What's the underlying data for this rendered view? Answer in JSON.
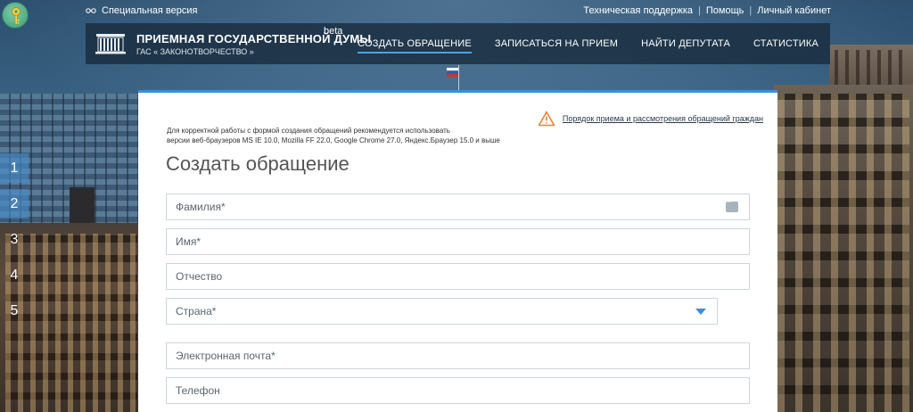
{
  "topbar": {
    "special_version": "Специальная версия",
    "links": [
      "Техническая поддержка",
      "Помощь",
      "Личный кабинет"
    ]
  },
  "header": {
    "title": "ПРИЕМНАЯ ГОСУДАРСТВЕННОЙ ДУМЫ",
    "beta": "beta",
    "subtitle": "ГАС « ЗАКОНОТВОРЧЕСТВО »",
    "nav": [
      {
        "label": "СОЗДАТЬ ОБРАЩЕНИЕ",
        "active": true
      },
      {
        "label": "ЗАПИСАТЬСЯ НА ПРИЕМ",
        "active": false
      },
      {
        "label": "НАЙТИ ДЕПУТАТА",
        "active": false
      },
      {
        "label": "СТАТИСТИКА",
        "active": false
      }
    ]
  },
  "sidenums": [
    "1",
    "2",
    "3",
    "4",
    "5"
  ],
  "form": {
    "notice_link": "Порядок приема и рассмотрения обращений граждан",
    "browser_note_line1": "Для корректной работы с формой создания обращений рекомендуется использовать",
    "browser_note_line2": "версии веб-браузеров MS IE 10.0, Mozilla FF 22.0, Google Chrome 27.0, Яндекс.Браузер 15.0 и выше",
    "title": "Создать обращение",
    "fields": {
      "lastname": "Фамилия*",
      "firstname": "Имя*",
      "patronymic": "Отчество",
      "country": "Страна*",
      "email": "Электронная почта*",
      "phone": "Телефон"
    }
  },
  "colors": {
    "accent": "#3f8fd8",
    "header_bg": "#182c3e",
    "warning": "#e8843a"
  }
}
